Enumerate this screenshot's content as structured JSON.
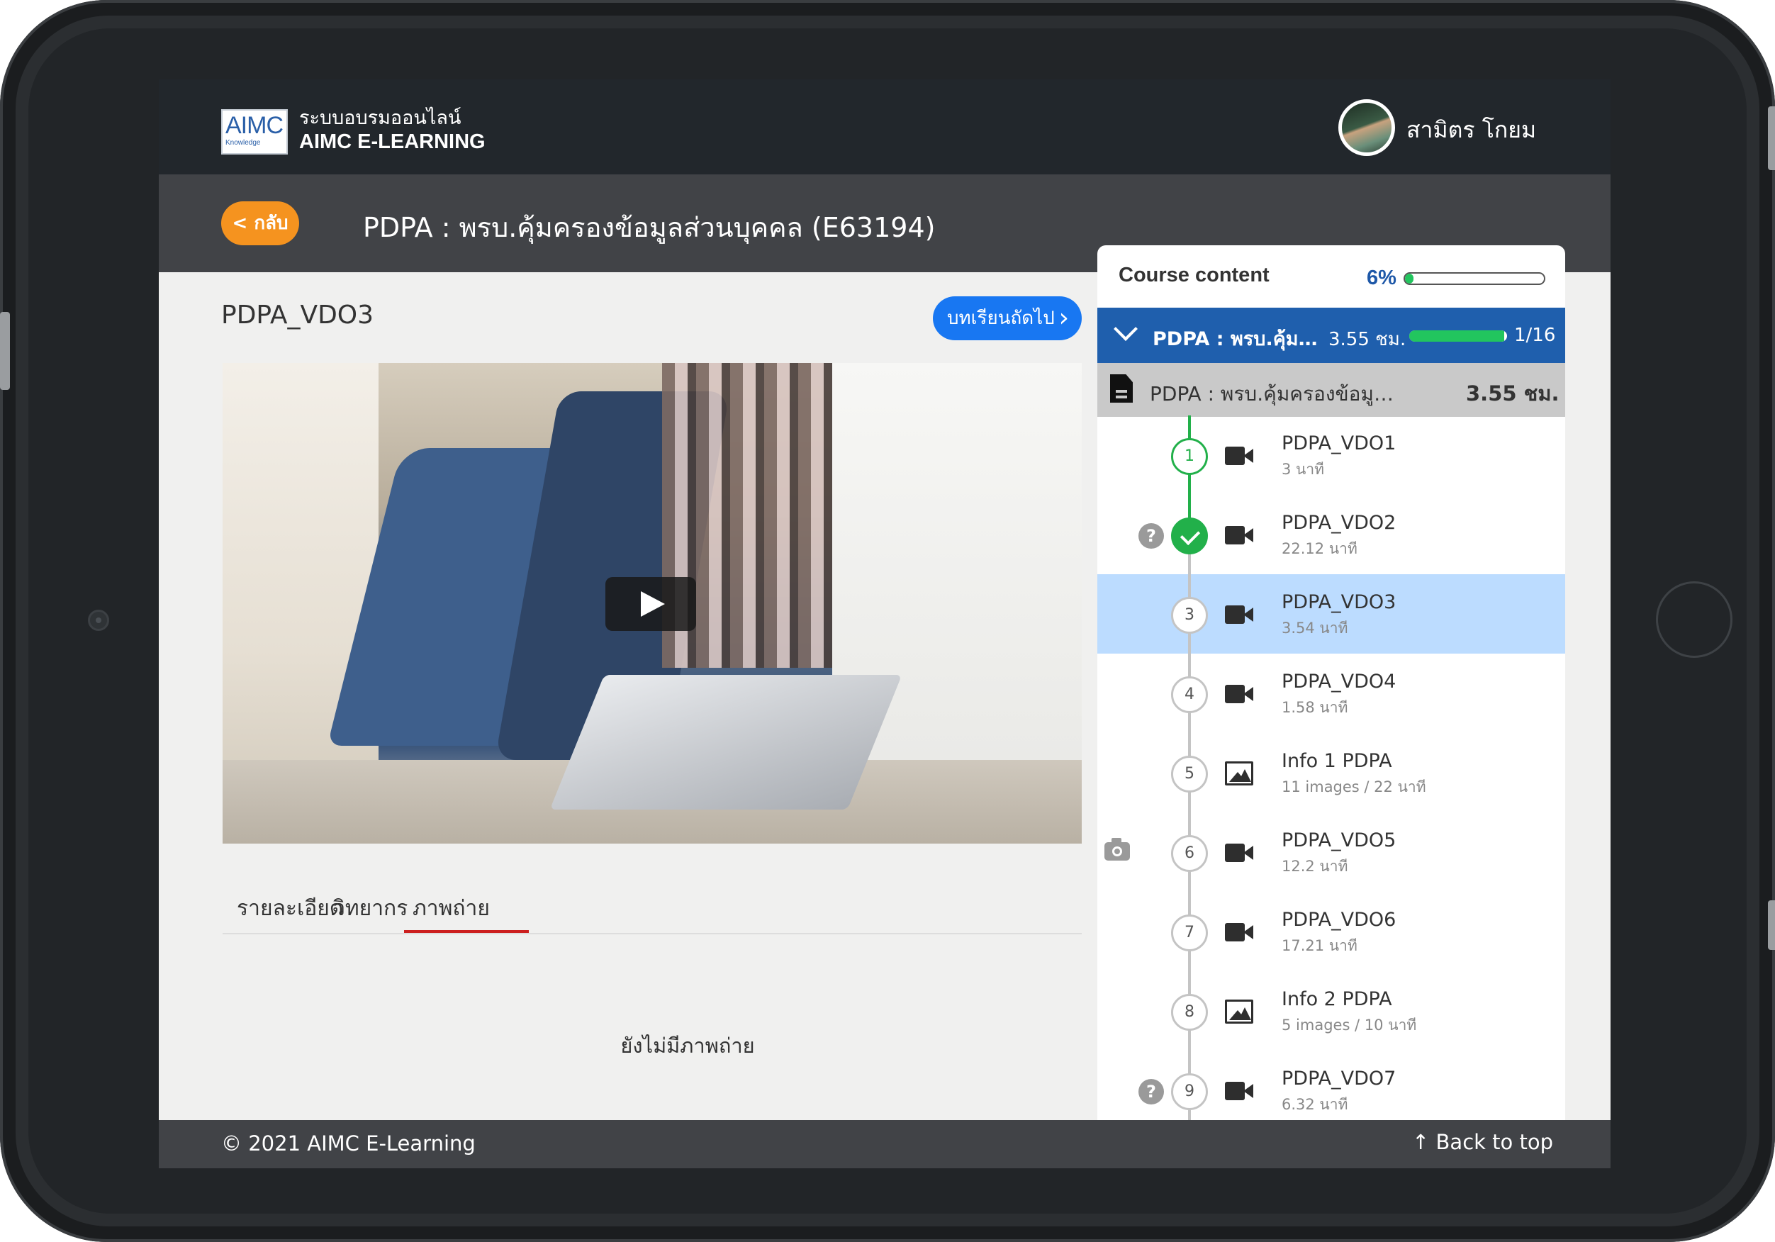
{
  "header": {
    "logo_text": "AIMC",
    "logo_sub": "Knowledge",
    "brand_line1": "ระบบอบรมออนไลน์",
    "brand_line2": "AIMC E-LEARNING",
    "username": "สามิตร โกยม"
  },
  "titlebar": {
    "back_label": "< กลับ",
    "course_title": "PDPA : พรบ.คุ้มครองข้อมูลส่วนบุคคล (E63194)"
  },
  "lesson": {
    "title": "PDPA_VDO3",
    "next_label": "บทเรียนถัดไป"
  },
  "tabs": [
    {
      "label": "รายละเอียด"
    },
    {
      "label": "วิทยากร"
    },
    {
      "label": "ภาพถ่าย"
    }
  ],
  "active_tab": "ภาพถ่าย",
  "empty_message": "ยังไม่มีภาพถ่าย",
  "footer": {
    "copyright": "© 2021 AIMC E-Learning",
    "back_to_top": "Back to top"
  },
  "course_content": {
    "label": "Course content",
    "progress_text": "6%",
    "progress_value": 0.06,
    "section": {
      "name": "PDPA : พรบ.คุ้มคร..",
      "hours": "3.55 ชม.",
      "progress_value": 0.97,
      "count": "1/16"
    },
    "subsection": {
      "name": "PDPA : พรบ.คุ้มครองข้อมูลส่วน...",
      "hours": "3.55 ชม."
    },
    "items": [
      {
        "num": "1",
        "title": "PDPA_VDO1",
        "sub": "3 นาที",
        "type": "video",
        "state": "current-green"
      },
      {
        "num": "",
        "title": "PDPA_VDO2",
        "sub": "22.12 นาที",
        "type": "video",
        "state": "done",
        "badge": "question"
      },
      {
        "num": "3",
        "title": "PDPA_VDO3",
        "sub": "3.54 นาที",
        "type": "video",
        "state": "active"
      },
      {
        "num": "4",
        "title": "PDPA_VDO4",
        "sub": "1.58 นาที",
        "type": "video",
        "state": "normal"
      },
      {
        "num": "5",
        "title": "Info 1 PDPA",
        "sub": "11 images / 22 นาที",
        "type": "images",
        "state": "normal"
      },
      {
        "num": "6",
        "title": "PDPA_VDO5",
        "sub": "12.2 นาที",
        "type": "video",
        "state": "normal",
        "badge": "camera"
      },
      {
        "num": "7",
        "title": "PDPA_VDO6",
        "sub": "17.21 นาที",
        "type": "video",
        "state": "normal"
      },
      {
        "num": "8",
        "title": "Info 2 PDPA",
        "sub": "5 images / 10 นาที",
        "type": "images",
        "state": "normal"
      },
      {
        "num": "9",
        "title": "PDPA_VDO7",
        "sub": "6.32 นาที",
        "type": "video",
        "state": "normal",
        "badge": "question"
      }
    ]
  }
}
